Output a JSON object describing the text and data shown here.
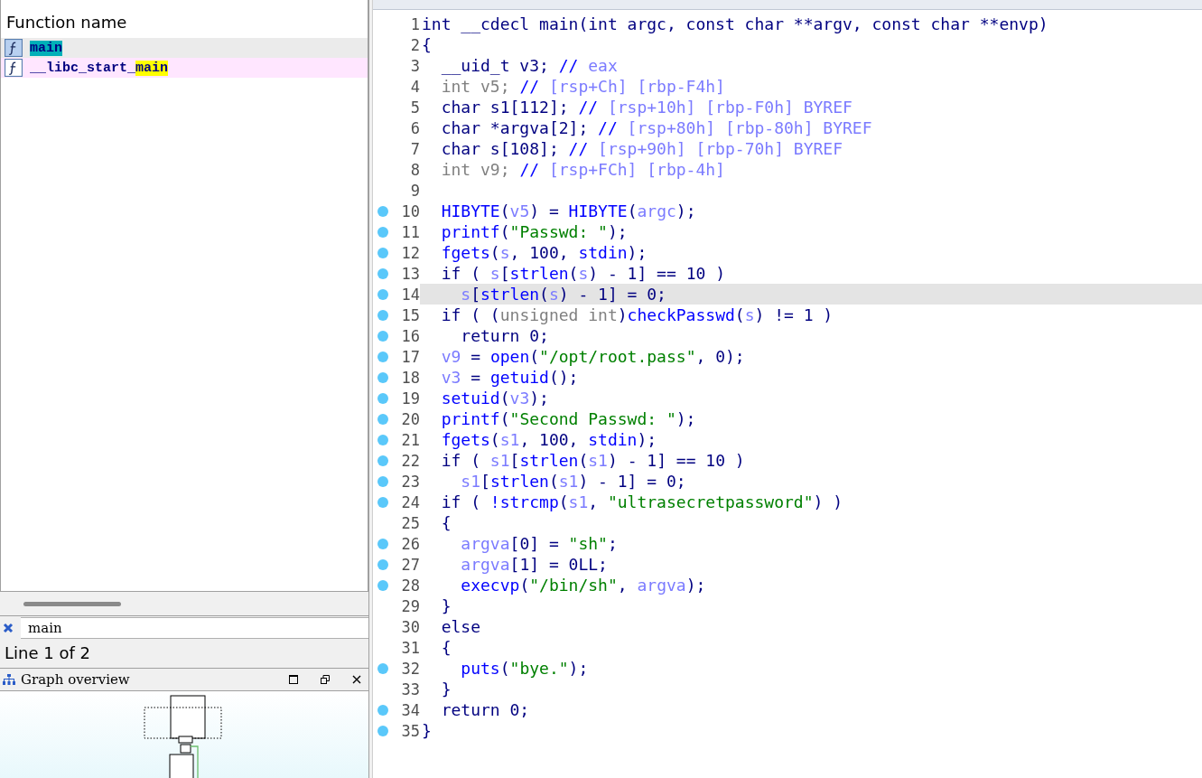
{
  "functions_panel": {
    "header": "Function name",
    "rows": [
      {
        "selected": true,
        "parts": [
          {
            "text": "main",
            "highlight": true
          }
        ]
      },
      {
        "selected": false,
        "parts": [
          {
            "text": "__libc_start_",
            "highlight": false
          },
          {
            "text": "main",
            "highlight": true
          }
        ]
      }
    ]
  },
  "search": {
    "value": "main"
  },
  "status": "Line 1 of 2",
  "graph_overview": {
    "title": "Graph overview"
  },
  "code": {
    "lines": [
      {
        "number": "1",
        "breakpoint": false,
        "highlighted": false,
        "tokens": [
          {
            "kind": "plain",
            "text": "int __cdecl main(int argc, const char **argv, const char **envp)"
          }
        ]
      },
      {
        "number": "2",
        "breakpoint": false,
        "highlighted": false,
        "tokens": [
          {
            "kind": "plain",
            "text": "{"
          }
        ]
      },
      {
        "number": "3",
        "breakpoint": false,
        "highlighted": false,
        "tokens": [
          {
            "kind": "plain",
            "text": "  __uid_t v3; "
          },
          {
            "kind": "comment",
            "text": "// "
          },
          {
            "kind": "note",
            "text": "eax"
          }
        ]
      },
      {
        "number": "4",
        "breakpoint": false,
        "highlighted": false,
        "tokens": [
          {
            "kind": "gray",
            "text": "  int v5; "
          },
          {
            "kind": "comment",
            "text": "// "
          },
          {
            "kind": "note",
            "text": "[rsp+Ch] [rbp-F4h]"
          }
        ]
      },
      {
        "number": "5",
        "breakpoint": false,
        "highlighted": false,
        "tokens": [
          {
            "kind": "plain",
            "text": "  char s1[112]; "
          },
          {
            "kind": "comment",
            "text": "// "
          },
          {
            "kind": "note",
            "text": "[rsp+10h] [rbp-F0h] BYREF"
          }
        ]
      },
      {
        "number": "6",
        "breakpoint": false,
        "highlighted": false,
        "tokens": [
          {
            "kind": "plain",
            "text": "  char *argva[2]; "
          },
          {
            "kind": "comment",
            "text": "// "
          },
          {
            "kind": "note",
            "text": "[rsp+80h] [rbp-80h] BYREF"
          }
        ]
      },
      {
        "number": "7",
        "breakpoint": false,
        "highlighted": false,
        "tokens": [
          {
            "kind": "plain",
            "text": "  char s[108]; "
          },
          {
            "kind": "comment",
            "text": "// "
          },
          {
            "kind": "note",
            "text": "[rsp+90h] [rbp-70h] BYREF"
          }
        ]
      },
      {
        "number": "8",
        "breakpoint": false,
        "highlighted": false,
        "tokens": [
          {
            "kind": "gray",
            "text": "  int v9; "
          },
          {
            "kind": "comment",
            "text": "// "
          },
          {
            "kind": "note",
            "text": "[rsp+FCh] [rbp-4h]"
          }
        ]
      },
      {
        "number": "9",
        "breakpoint": false,
        "highlighted": false
      },
      {
        "number": "10",
        "breakpoint": true,
        "highlighted": false,
        "tokens": [
          {
            "kind": "func",
            "text": "  HIBYTE"
          },
          {
            "kind": "plain",
            "text": "("
          },
          {
            "kind": "var",
            "text": "v5"
          },
          {
            "kind": "plain",
            "text": ") = "
          },
          {
            "kind": "func",
            "text": "HIBYTE"
          },
          {
            "kind": "plain",
            "text": "("
          },
          {
            "kind": "var",
            "text": "argc"
          },
          {
            "kind": "plain",
            "text": ");"
          }
        ]
      },
      {
        "number": "11",
        "breakpoint": true,
        "highlighted": false,
        "tokens": [
          {
            "kind": "func",
            "text": "  printf"
          },
          {
            "kind": "plain",
            "text": "("
          },
          {
            "kind": "str",
            "text": "\"Passwd: \""
          },
          {
            "kind": "plain",
            "text": ");"
          }
        ]
      },
      {
        "number": "12",
        "breakpoint": true,
        "highlighted": false,
        "tokens": [
          {
            "kind": "func",
            "text": "  fgets"
          },
          {
            "kind": "plain",
            "text": "("
          },
          {
            "kind": "var",
            "text": "s"
          },
          {
            "kind": "plain",
            "text": ", 100, "
          },
          {
            "kind": "func",
            "text": "stdin"
          },
          {
            "kind": "plain",
            "text": ");"
          }
        ]
      },
      {
        "number": "13",
        "breakpoint": true,
        "highlighted": false,
        "tokens": [
          {
            "kind": "plain",
            "text": "  if ( "
          },
          {
            "kind": "var",
            "text": "s"
          },
          {
            "kind": "plain",
            "text": "["
          },
          {
            "kind": "func",
            "text": "strlen"
          },
          {
            "kind": "plain",
            "text": "("
          },
          {
            "kind": "var",
            "text": "s"
          },
          {
            "kind": "plain",
            "text": ") - 1] == 10 )"
          }
        ]
      },
      {
        "number": "14",
        "breakpoint": true,
        "highlighted": true,
        "tokens": [
          {
            "kind": "var",
            "text": "    s"
          },
          {
            "kind": "plain",
            "text": "["
          },
          {
            "kind": "func",
            "text": "strlen"
          },
          {
            "kind": "plain",
            "text": "("
          },
          {
            "kind": "var",
            "text": "s"
          },
          {
            "kind": "plain",
            "text": ") - 1] = 0;"
          }
        ]
      },
      {
        "number": "15",
        "breakpoint": true,
        "highlighted": false,
        "tokens": [
          {
            "kind": "plain",
            "text": "  if ( ("
          },
          {
            "kind": "gray",
            "text": "unsigned int"
          },
          {
            "kind": "plain",
            "text": ")"
          },
          {
            "kind": "func",
            "text": "checkPasswd"
          },
          {
            "kind": "plain",
            "text": "("
          },
          {
            "kind": "var",
            "text": "s"
          },
          {
            "kind": "plain",
            "text": ") != 1 )"
          }
        ]
      },
      {
        "number": "16",
        "breakpoint": true,
        "highlighted": false,
        "tokens": [
          {
            "kind": "plain",
            "text": "    return 0;"
          }
        ]
      },
      {
        "number": "17",
        "breakpoint": true,
        "highlighted": false,
        "tokens": [
          {
            "kind": "var",
            "text": "  v9"
          },
          {
            "kind": "plain",
            "text": " = "
          },
          {
            "kind": "func",
            "text": "open"
          },
          {
            "kind": "plain",
            "text": "("
          },
          {
            "kind": "str",
            "text": "\"/opt/root.pass\""
          },
          {
            "kind": "plain",
            "text": ", 0);"
          }
        ]
      },
      {
        "number": "18",
        "breakpoint": true,
        "highlighted": false,
        "tokens": [
          {
            "kind": "var",
            "text": "  v3"
          },
          {
            "kind": "plain",
            "text": " = "
          },
          {
            "kind": "func",
            "text": "getuid"
          },
          {
            "kind": "plain",
            "text": "();"
          }
        ]
      },
      {
        "number": "19",
        "breakpoint": true,
        "highlighted": false,
        "tokens": [
          {
            "kind": "func",
            "text": "  setuid"
          },
          {
            "kind": "plain",
            "text": "("
          },
          {
            "kind": "var",
            "text": "v3"
          },
          {
            "kind": "plain",
            "text": ");"
          }
        ]
      },
      {
        "number": "20",
        "breakpoint": true,
        "highlighted": false,
        "tokens": [
          {
            "kind": "func",
            "text": "  printf"
          },
          {
            "kind": "plain",
            "text": "("
          },
          {
            "kind": "str",
            "text": "\"Second Passwd: \""
          },
          {
            "kind": "plain",
            "text": ");"
          }
        ]
      },
      {
        "number": "21",
        "breakpoint": true,
        "highlighted": false,
        "tokens": [
          {
            "kind": "func",
            "text": "  fgets"
          },
          {
            "kind": "plain",
            "text": "("
          },
          {
            "kind": "var",
            "text": "s1"
          },
          {
            "kind": "plain",
            "text": ", 100, "
          },
          {
            "kind": "func",
            "text": "stdin"
          },
          {
            "kind": "plain",
            "text": ");"
          }
        ]
      },
      {
        "number": "22",
        "breakpoint": true,
        "highlighted": false,
        "tokens": [
          {
            "kind": "plain",
            "text": "  if ( "
          },
          {
            "kind": "var",
            "text": "s1"
          },
          {
            "kind": "plain",
            "text": "["
          },
          {
            "kind": "func",
            "text": "strlen"
          },
          {
            "kind": "plain",
            "text": "("
          },
          {
            "kind": "var",
            "text": "s1"
          },
          {
            "kind": "plain",
            "text": ") - 1] == 10 )"
          }
        ]
      },
      {
        "number": "23",
        "breakpoint": true,
        "highlighted": false,
        "tokens": [
          {
            "kind": "var",
            "text": "    s1"
          },
          {
            "kind": "plain",
            "text": "["
          },
          {
            "kind": "func",
            "text": "strlen"
          },
          {
            "kind": "plain",
            "text": "("
          },
          {
            "kind": "var",
            "text": "s1"
          },
          {
            "kind": "plain",
            "text": ") - 1] = 0;"
          }
        ]
      },
      {
        "number": "24",
        "breakpoint": true,
        "highlighted": false,
        "tokens": [
          {
            "kind": "plain",
            "text": "  if ( "
          },
          {
            "kind": "func",
            "text": "!strcmp"
          },
          {
            "kind": "plain",
            "text": "("
          },
          {
            "kind": "var",
            "text": "s1"
          },
          {
            "kind": "plain",
            "text": ", "
          },
          {
            "kind": "str",
            "text": "\"ultrasecretpassword\""
          },
          {
            "kind": "plain",
            "text": ") )"
          }
        ]
      },
      {
        "number": "25",
        "breakpoint": false,
        "highlighted": false,
        "tokens": [
          {
            "kind": "plain",
            "text": "  {"
          }
        ]
      },
      {
        "number": "26",
        "breakpoint": true,
        "highlighted": false,
        "tokens": [
          {
            "kind": "var",
            "text": "    argva"
          },
          {
            "kind": "plain",
            "text": "[0] = "
          },
          {
            "kind": "str",
            "text": "\"sh\""
          },
          {
            "kind": "plain",
            "text": ";"
          }
        ]
      },
      {
        "number": "27",
        "breakpoint": true,
        "highlighted": false,
        "tokens": [
          {
            "kind": "var",
            "text": "    argva"
          },
          {
            "kind": "plain",
            "text": "[1] = 0LL;"
          }
        ]
      },
      {
        "number": "28",
        "breakpoint": true,
        "highlighted": false,
        "tokens": [
          {
            "kind": "func",
            "text": "    execvp"
          },
          {
            "kind": "plain",
            "text": "("
          },
          {
            "kind": "str",
            "text": "\"/bin/sh\""
          },
          {
            "kind": "plain",
            "text": ", "
          },
          {
            "kind": "var",
            "text": "argva"
          },
          {
            "kind": "plain",
            "text": ");"
          }
        ]
      },
      {
        "number": "29",
        "breakpoint": false,
        "highlighted": false,
        "tokens": [
          {
            "kind": "plain",
            "text": "  }"
          }
        ]
      },
      {
        "number": "30",
        "breakpoint": false,
        "highlighted": false,
        "tokens": [
          {
            "kind": "plain",
            "text": "  else"
          }
        ]
      },
      {
        "number": "31",
        "breakpoint": false,
        "highlighted": false,
        "tokens": [
          {
            "kind": "plain",
            "text": "  {"
          }
        ]
      },
      {
        "number": "32",
        "breakpoint": true,
        "highlighted": false,
        "tokens": [
          {
            "kind": "func",
            "text": "    puts"
          },
          {
            "kind": "plain",
            "text": "("
          },
          {
            "kind": "str",
            "text": "\"bye.\""
          },
          {
            "kind": "plain",
            "text": ");"
          }
        ]
      },
      {
        "number": "33",
        "breakpoint": false,
        "highlighted": false,
        "tokens": [
          {
            "kind": "plain",
            "text": "  }"
          }
        ]
      },
      {
        "number": "34",
        "breakpoint": true,
        "highlighted": false,
        "tokens": [
          {
            "kind": "plain",
            "text": "  return 0;"
          }
        ]
      },
      {
        "number": "35",
        "breakpoint": true,
        "highlighted": false,
        "tokens": [
          {
            "kind": "plain",
            "text": "}"
          }
        ]
      }
    ]
  }
}
